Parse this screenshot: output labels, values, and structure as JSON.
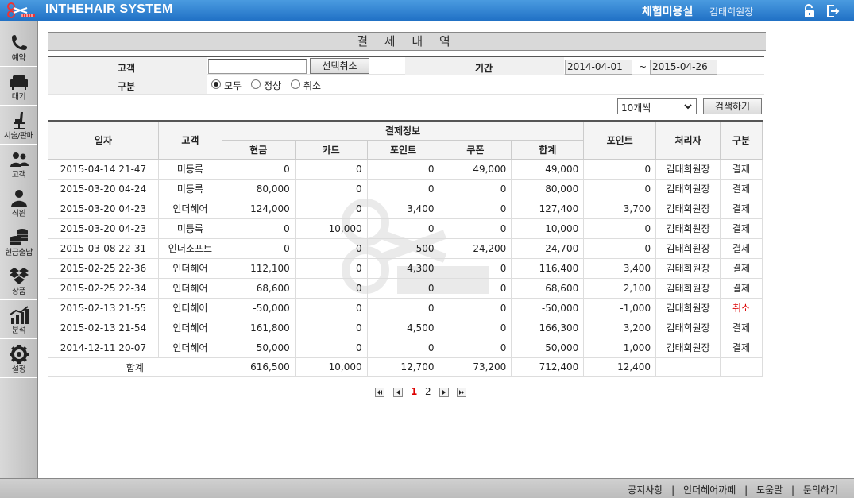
{
  "app": {
    "title": "INTHEHAIR SYSTEM",
    "salon_name": "체험미용실",
    "user_name": "김태희원장"
  },
  "sidebar": {
    "items": [
      {
        "label": "예약",
        "icon": "phone-icon"
      },
      {
        "label": "대기",
        "icon": "sofa-icon"
      },
      {
        "label": "시술/판매",
        "icon": "chair-icon"
      },
      {
        "label": "고객",
        "icon": "users-icon"
      },
      {
        "label": "직원",
        "icon": "person-icon"
      },
      {
        "label": "현금출납",
        "icon": "coins-icon"
      },
      {
        "label": "상품",
        "icon": "box-icon"
      },
      {
        "label": "분석",
        "icon": "chart-icon"
      },
      {
        "label": "설정",
        "icon": "gear-icon"
      }
    ]
  },
  "page": {
    "title": "결 제 내 역"
  },
  "filters": {
    "customer_label": "고객",
    "customer_value": "",
    "deselect_button": "선택취소",
    "period_label": "기간",
    "date_from": "2014-04-01",
    "date_sep": "~",
    "date_to": "2015-04-26",
    "type_label": "구분",
    "type_options": [
      "모두",
      "정상",
      "취소"
    ],
    "type_selected": "모두",
    "page_size": "10개씩",
    "search_button": "검색하기"
  },
  "table": {
    "headers": {
      "date": "일자",
      "customer": "고객",
      "payment_group": "결제정보",
      "cash": "현금",
      "card": "카드",
      "point": "포인트",
      "coupon": "쿠폰",
      "sum": "합계",
      "point_earned": "포인트",
      "handler": "처리자",
      "type": "구분"
    },
    "rows": [
      {
        "date": "2015-04-14 21-47",
        "customer": "미등록",
        "cash": "0",
        "card": "0",
        "point": "0",
        "coupon": "49,000",
        "sum": "49,000",
        "point_earned": "0",
        "handler": "김태희원장",
        "type": "결제"
      },
      {
        "date": "2015-03-20 04-24",
        "customer": "미등록",
        "cash": "80,000",
        "card": "0",
        "point": "0",
        "coupon": "0",
        "sum": "80,000",
        "point_earned": "0",
        "handler": "김태희원장",
        "type": "결제"
      },
      {
        "date": "2015-03-20 04-23",
        "customer": "인더헤어",
        "cash": "124,000",
        "card": "0",
        "point": "3,400",
        "coupon": "0",
        "sum": "127,400",
        "point_earned": "3,700",
        "handler": "김태희원장",
        "type": "결제"
      },
      {
        "date": "2015-03-20 04-23",
        "customer": "미등록",
        "cash": "0",
        "card": "10,000",
        "point": "0",
        "coupon": "0",
        "sum": "10,000",
        "point_earned": "0",
        "handler": "김태희원장",
        "type": "결제"
      },
      {
        "date": "2015-03-08 22-31",
        "customer": "인더소프트",
        "cash": "0",
        "card": "0",
        "point": "500",
        "coupon": "24,200",
        "sum": "24,700",
        "point_earned": "0",
        "handler": "김태희원장",
        "type": "결제"
      },
      {
        "date": "2015-02-25 22-36",
        "customer": "인더헤어",
        "cash": "112,100",
        "card": "0",
        "point": "4,300",
        "coupon": "0",
        "sum": "116,400",
        "point_earned": "3,400",
        "handler": "김태희원장",
        "type": "결제"
      },
      {
        "date": "2015-02-25 22-34",
        "customer": "인더헤어",
        "cash": "68,600",
        "card": "0",
        "point": "0",
        "coupon": "0",
        "sum": "68,600",
        "point_earned": "2,100",
        "handler": "김태희원장",
        "type": "결제"
      },
      {
        "date": "2015-02-13 21-55",
        "customer": "인더헤어",
        "cash": "-50,000",
        "card": "0",
        "point": "0",
        "coupon": "0",
        "sum": "-50,000",
        "point_earned": "-1,000",
        "handler": "김태희원장",
        "type": "취소"
      },
      {
        "date": "2015-02-13 21-54",
        "customer": "인더헤어",
        "cash": "161,800",
        "card": "0",
        "point": "4,500",
        "coupon": "0",
        "sum": "166,300",
        "point_earned": "3,200",
        "handler": "김태희원장",
        "type": "결제"
      },
      {
        "date": "2014-12-11 20-07",
        "customer": "인더헤어",
        "cash": "50,000",
        "card": "0",
        "point": "0",
        "coupon": "0",
        "sum": "50,000",
        "point_earned": "1,000",
        "handler": "김태희원장",
        "type": "결제"
      }
    ],
    "total": {
      "label": "합계",
      "cash": "616,500",
      "card": "10,000",
      "point": "12,700",
      "coupon": "73,200",
      "sum": "712,400",
      "point_earned": "12,400"
    }
  },
  "pagination": {
    "pages": [
      "1",
      "2"
    ],
    "current": "1"
  },
  "footer": {
    "links": [
      "공지사항",
      "인더헤어까페",
      "도움말",
      "문의하기"
    ],
    "separator": "|"
  },
  "colors": {
    "topbar": "#2a7fd4",
    "cancel": "#dd0000",
    "current_page": "#dd0000"
  }
}
